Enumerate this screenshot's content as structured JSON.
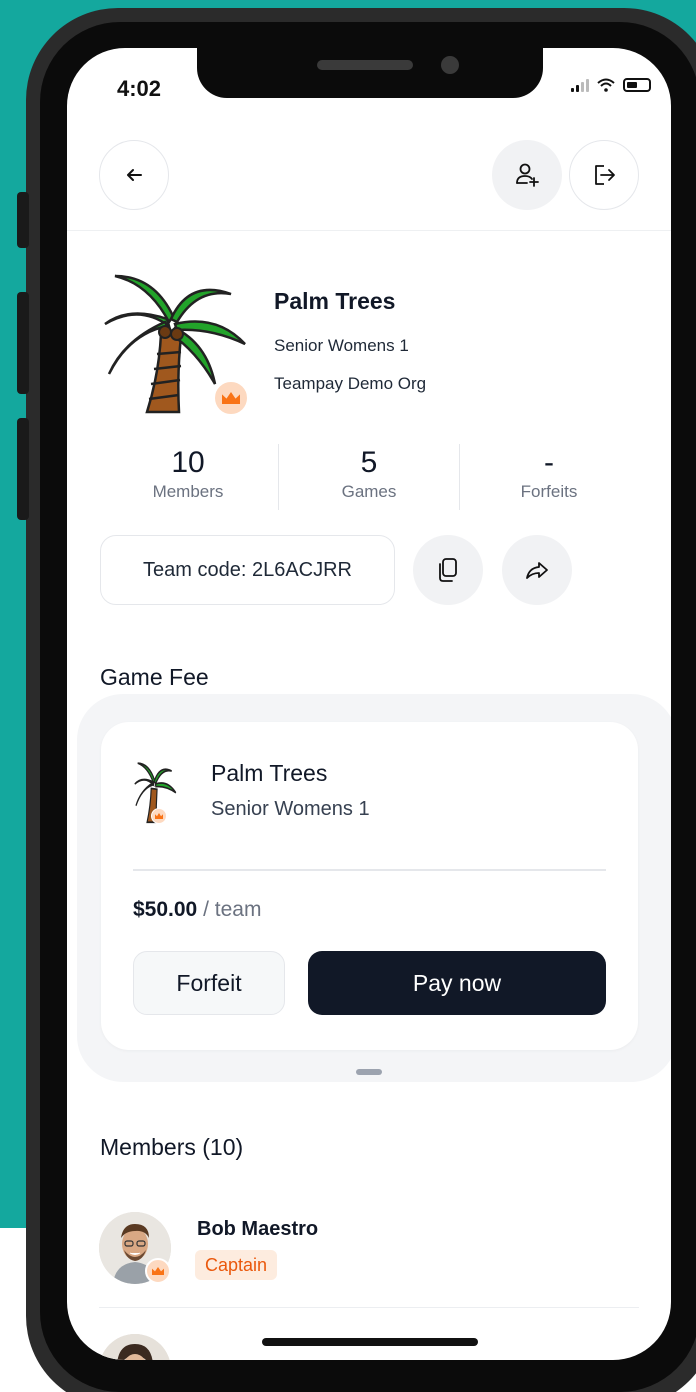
{
  "status_bar": {
    "time": "4:02"
  },
  "header": {
    "back_icon": "arrow-left-icon",
    "add_member_icon": "user-plus-icon",
    "leave_icon": "logout-icon"
  },
  "team": {
    "name": "Palm Trees",
    "division": "Senior Womens 1",
    "organization": "Teampay Demo Org",
    "logo_icon": "palm-tree-icon",
    "badge_icon": "crown-icon"
  },
  "stats": [
    {
      "value": "10",
      "label": "Members"
    },
    {
      "value": "5",
      "label": "Games"
    },
    {
      "value": "-",
      "label": "Forfeits"
    }
  ],
  "team_code": {
    "label": "Team code: 2L6ACJRR",
    "copy_icon": "copy-icon",
    "share_icon": "share-icon"
  },
  "game_fee": {
    "section_title": "Game Fee",
    "team_name": "Palm Trees",
    "division": "Senior Womens 1",
    "amount": "$50.00",
    "unit": "/ team",
    "forfeit_label": "Forfeit",
    "pay_label": "Pay now"
  },
  "members": {
    "section_title": "Members (10)",
    "items": [
      {
        "name": "Bob Maestro",
        "role": "Captain"
      }
    ]
  },
  "colors": {
    "background_accent": "#14a89e",
    "primary_button": "#111827",
    "captain_badge_text": "#ea580c",
    "captain_badge_bg": "#fdecdf"
  }
}
